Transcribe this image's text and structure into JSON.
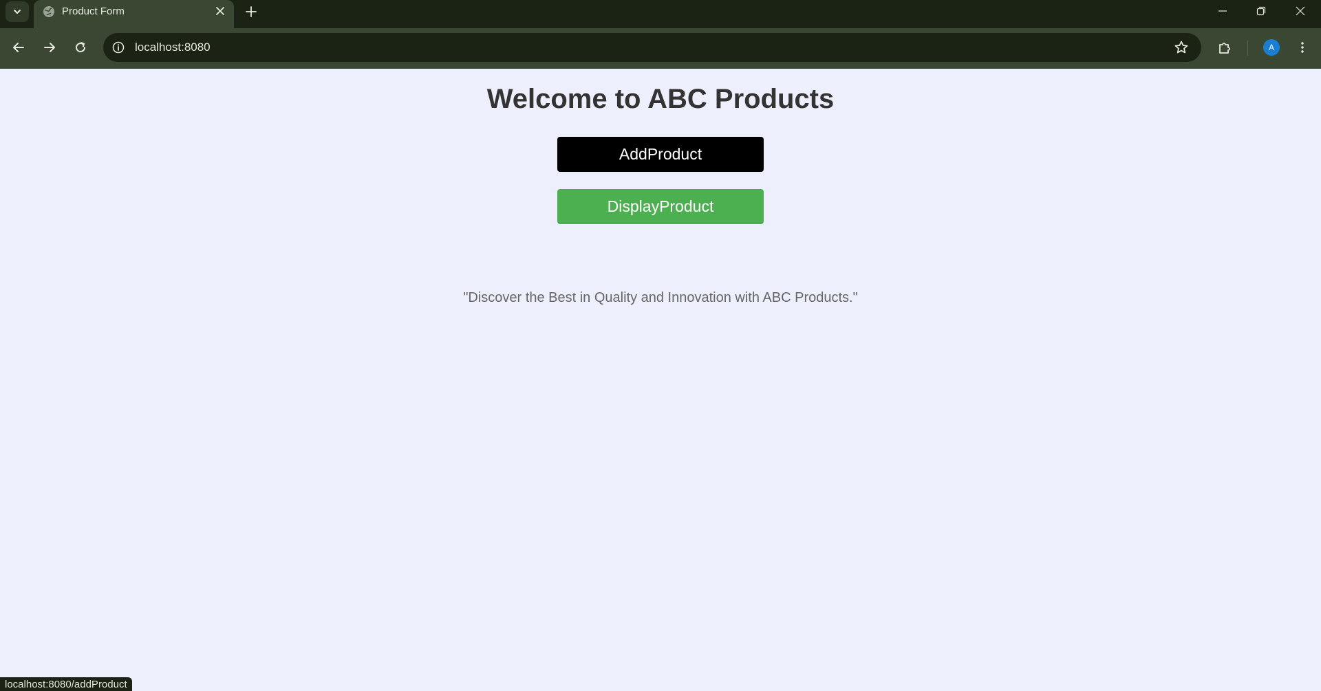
{
  "browser": {
    "tab": {
      "title": "Product Form",
      "favicon": "globe-icon"
    },
    "address_bar": {
      "url": "localhost:8080"
    },
    "profile": {
      "initial": "A",
      "color": "#1a7fd4"
    },
    "status_url": "localhost:8080/addProduct"
  },
  "page": {
    "title": "Welcome to ABC Products",
    "buttons": {
      "add": {
        "label": "AddProduct",
        "color": "#000000"
      },
      "display": {
        "label": "DisplayProduct",
        "color": "#4caf50"
      }
    },
    "tagline": "\"Discover the Best in Quality and Innovation with ABC Products.\""
  }
}
